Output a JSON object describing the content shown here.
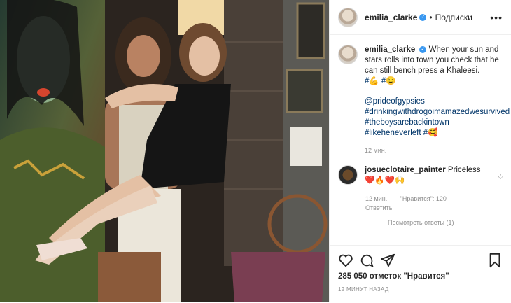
{
  "post": {
    "username": "emilia_clarke",
    "verified_mark": "✓",
    "follow_label": "Подписки",
    "more_label": "•••",
    "caption_text": "When your sun and stars rolls into town you check that he can still bench press a Khaleesi.",
    "caption_tags_line": "#💪 #😉",
    "mention": "@prideofgypsies",
    "hashtags": [
      "#drinkingwithdrogoimamazedwesurvived",
      "#theboysarebackintown",
      "#likeheneverleft #🥰"
    ],
    "caption_time": "12 мин."
  },
  "comment": {
    "username": "josueclotaire_painter",
    "text": "Priceless",
    "emoji": "❤️🔥❤️🙌",
    "time": "12 мин.",
    "likes_label": "\"Нравится\": 120",
    "reply_label": "Ответить",
    "view_replies": "Посмотреть ответы (1)"
  },
  "footer": {
    "likes": "285 050 отметок \"Нравится\"",
    "time_ago": "12 МИНУТ НАЗАД"
  },
  "icons": [
    "heart-icon",
    "comment-icon",
    "share-icon",
    "bookmark-icon"
  ],
  "colors": {
    "link": "#003569",
    "verified": "#3897f0",
    "muted": "#8e8e8e"
  }
}
